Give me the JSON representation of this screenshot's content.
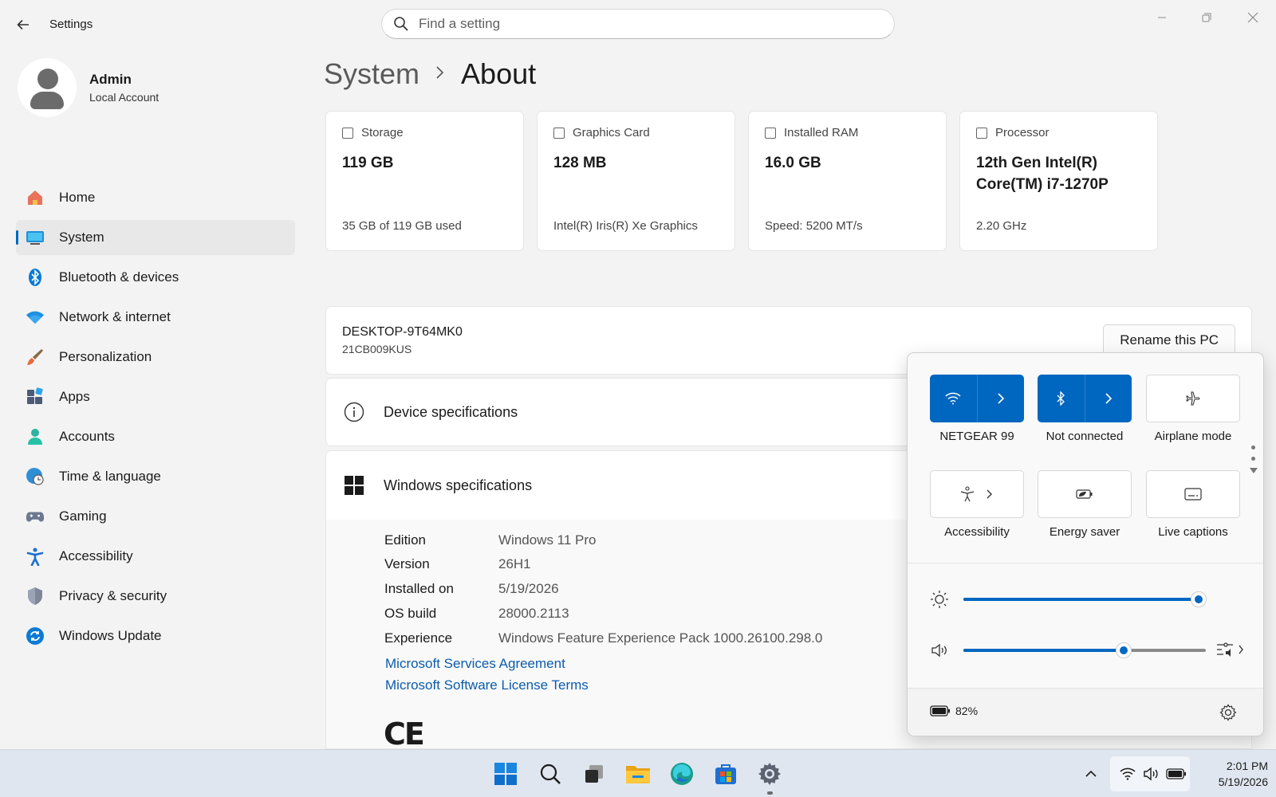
{
  "app": {
    "title": "Settings",
    "search_placeholder": "Find a setting"
  },
  "profile": {
    "name": "Admin",
    "account_type": "Local Account"
  },
  "sidebar": {
    "items": [
      {
        "label": "Home",
        "icon": "home-icon"
      },
      {
        "label": "System",
        "icon": "system-icon",
        "active": true
      },
      {
        "label": "Bluetooth & devices",
        "icon": "bluetooth-icon"
      },
      {
        "label": "Network & internet",
        "icon": "wifi-icon"
      },
      {
        "label": "Personalization",
        "icon": "brush-icon"
      },
      {
        "label": "Apps",
        "icon": "apps-icon"
      },
      {
        "label": "Accounts",
        "icon": "accounts-icon"
      },
      {
        "label": "Time & language",
        "icon": "globe-clock-icon"
      },
      {
        "label": "Gaming",
        "icon": "gamepad-icon"
      },
      {
        "label": "Accessibility",
        "icon": "accessibility-icon"
      },
      {
        "label": "Privacy & security",
        "icon": "shield-icon"
      },
      {
        "label": "Windows Update",
        "icon": "update-icon"
      }
    ]
  },
  "breadcrumb": {
    "parent": "System",
    "current": "About"
  },
  "spec_cards": [
    {
      "label": "Storage",
      "value": "119 GB",
      "sub": "35 GB of 119 GB used",
      "icon": "storage-icon"
    },
    {
      "label": "Graphics Card",
      "value": "128 MB",
      "sub": "Intel(R) Iris(R) Xe Graphics",
      "icon": "graphics-card-icon"
    },
    {
      "label": "Installed RAM",
      "value": "16.0 GB",
      "sub": "Speed: 5200 MT/s",
      "icon": "ram-icon"
    },
    {
      "label": "Processor",
      "value": "12th Gen Intel(R) Core(TM) i7-1270P",
      "sub": "2.20 GHz",
      "icon": "processor-icon"
    }
  ],
  "pc": {
    "name": "DESKTOP-9T64MK0",
    "model": "21CB009KUS",
    "rename_label": "Rename this PC"
  },
  "sections": {
    "device_specs": "Device specifications",
    "windows_specs": "Windows specifications"
  },
  "windows_specs": {
    "rows": [
      {
        "key": "Edition",
        "value": "Windows 11 Pro"
      },
      {
        "key": "Version",
        "value": "26H1"
      },
      {
        "key": "Installed on",
        "value": "5/19/2026"
      },
      {
        "key": "OS build",
        "value": "28000.2113"
      },
      {
        "key": "Experience",
        "value": "Windows Feature Experience Pack 1000.26100.298.0"
      }
    ],
    "links": [
      "Microsoft Services Agreement",
      "Microsoft Software License Terms"
    ],
    "ce_mark": "CE"
  },
  "quick_settings": {
    "tiles": [
      {
        "label": "NETGEAR 99",
        "icon": "wifi-icon",
        "state": "on",
        "expandable": true
      },
      {
        "label": "Not connected",
        "icon": "bluetooth-icon",
        "state": "on",
        "expandable": true
      },
      {
        "label": "Airplane mode",
        "icon": "airplane-icon",
        "state": "off",
        "expandable": false
      },
      {
        "label": "Accessibility",
        "icon": "accessibility-icon",
        "state": "off",
        "expandable": true
      },
      {
        "label": "Energy saver",
        "icon": "energy-saver-icon",
        "state": "off",
        "expandable": false
      },
      {
        "label": "Live captions",
        "icon": "captions-icon",
        "state": "off",
        "expandable": false
      }
    ],
    "brightness": 0.97,
    "volume": 0.66,
    "battery_percent": "82%"
  },
  "taskbar": {
    "apps": [
      "start-icon",
      "search-icon",
      "task-view-icon",
      "file-explorer-icon",
      "edge-icon",
      "store-icon",
      "settings-icon"
    ],
    "time": "2:01 PM",
    "date": "5/19/2026"
  },
  "colors": {
    "accent": "#0067c0",
    "link": "#0b5cad"
  }
}
